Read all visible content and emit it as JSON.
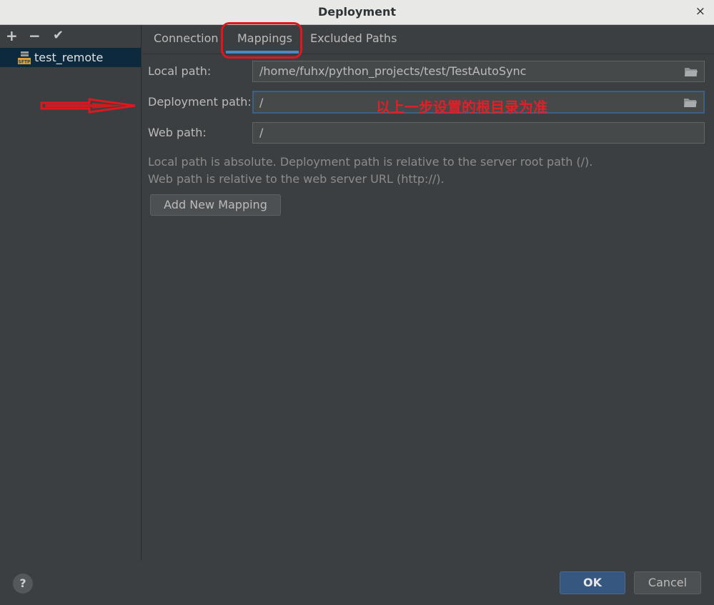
{
  "window": {
    "title": "Deployment",
    "close_symbol": "×"
  },
  "sidebar": {
    "toolbar": {
      "add": "+",
      "remove": "−",
      "apply": "✔"
    },
    "servers": [
      {
        "name": "test_remote",
        "icon": "sftp-server-icon",
        "icon_text": "SFTP"
      }
    ]
  },
  "tabs": [
    {
      "label": "Connection",
      "active": false
    },
    {
      "label": "Mappings",
      "active": true
    },
    {
      "label": "Excluded Paths",
      "active": false
    }
  ],
  "mappings": {
    "local_path": {
      "label": "Local path:",
      "value": "/home/fuhx/python_projects/test/TestAutoSync"
    },
    "deployment_path": {
      "label": "Deployment path:",
      "value": "/"
    },
    "web_path": {
      "label": "Web path:",
      "value": "/"
    },
    "info_line1": "Local path is absolute. Deployment path is relative to the server root path (/).",
    "info_line2": "Web path is relative to the web server URL (http://).",
    "add_button": "Add New Mapping"
  },
  "annotation": {
    "text": "以上一步设置的根目录为准",
    "color": "#e21f26"
  },
  "footer": {
    "help": "?",
    "ok": "OK",
    "cancel": "Cancel"
  },
  "colors": {
    "accent": "#4a88c7",
    "ok_button": "#365880",
    "selection": "#0d293e",
    "annotation": "#e0171f"
  }
}
